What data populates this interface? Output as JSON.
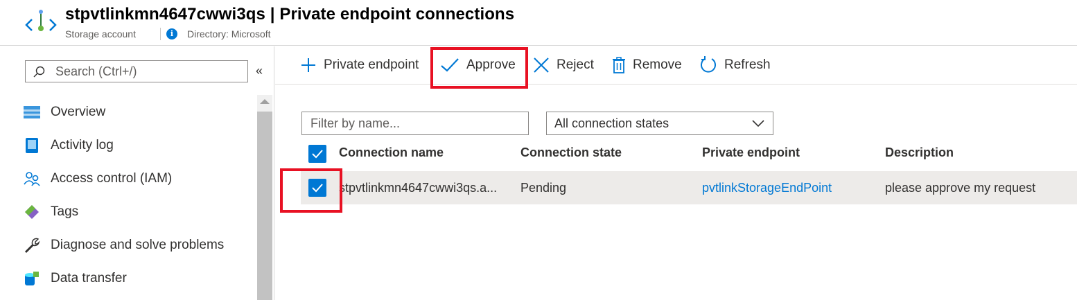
{
  "header": {
    "title": "stpvtlinkmn4647cwwi3qs | Private endpoint connections",
    "subtitle": "Storage account",
    "directory": "Directory: Microsoft",
    "info_glyph": "i"
  },
  "leftnav": {
    "search_placeholder": "Search (Ctrl+/)",
    "collapse_glyph": "«",
    "items": [
      {
        "label": "Overview",
        "icon": "overview-icon"
      },
      {
        "label": "Activity log",
        "icon": "activity-log-icon"
      },
      {
        "label": "Access control (IAM)",
        "icon": "iam-icon"
      },
      {
        "label": "Tags",
        "icon": "tag-icon"
      },
      {
        "label": "Diagnose and solve problems",
        "icon": "wrench-icon"
      },
      {
        "label": "Data transfer",
        "icon": "data-transfer-icon"
      }
    ]
  },
  "toolbar": {
    "add_label": "Private endpoint",
    "approve_label": "Approve",
    "reject_label": "Reject",
    "remove_label": "Remove",
    "refresh_label": "Refresh"
  },
  "filters": {
    "name_placeholder": "Filter by name...",
    "state_value": "All connection states"
  },
  "table": {
    "columns": [
      "Connection name",
      "Connection state",
      "Private endpoint",
      "Description"
    ],
    "rows": [
      {
        "name": "stpvtlinkmn4647cwwi3qs.a...",
        "state": "Pending",
        "endpoint": "pvtlinkStorageEndPoint",
        "description": "please approve my request",
        "selected": true
      }
    ]
  },
  "colors": {
    "accent": "#0078d4",
    "highlight": "#e81123",
    "row_selected": "#edebe9"
  }
}
